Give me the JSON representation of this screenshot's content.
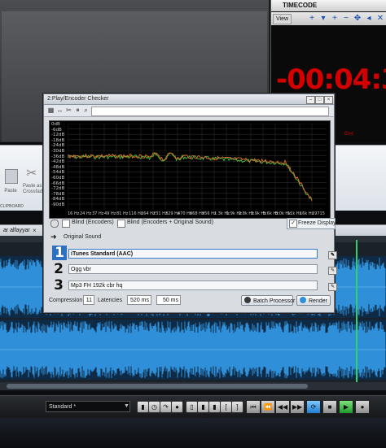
{
  "timecode_panel": {
    "title": "TIMECODE",
    "view_label": "View",
    "value": "-00:04:3",
    "red_text": "End"
  },
  "ribbon": {
    "paste_label": "Paste",
    "paste_as_label": "Paste as\nCrossfade",
    "clipboard_label": "CLIPBOARD"
  },
  "track": {
    "name": "ar alfayyar",
    "close": "×"
  },
  "dialog": {
    "title": "2:Play/Encoder Checker",
    "window_buttons": [
      "–",
      "□",
      "×"
    ],
    "spectrum": {
      "y_labels": [
        "0dB",
        "-6dB",
        "-12dB",
        "-18dB",
        "-24dB",
        "-30dB",
        "-36dB",
        "-42dB",
        "-48dB",
        "-54dB",
        "-60dB",
        "-66dB",
        "-72dB",
        "-78dB",
        "-84dB",
        "-90dB"
      ],
      "x_labels": [
        "16 Hz",
        "24 Hz",
        "37 Hz",
        "49 Hz",
        "81 Hz",
        "116 Hz",
        "164 Hz",
        "231 Hz",
        "329 Hz",
        "470 Hz",
        "668 Hz",
        "956 Hz",
        "1.3k Hz",
        "1.9k Hz",
        "2.8k Hz",
        "3.9k Hz",
        "5.6k Hz",
        "8.0k Hz",
        "11k Hz",
        "16k Hz",
        "19715"
      ]
    },
    "options": {
      "blind_encoders": "Blind (Encoders)",
      "blind_encoders_original": "Blind (Encoders + Original Sound)",
      "freeze_display": "Freeze Display",
      "freeze_checked": "✓"
    },
    "original_sound": "Original Sound",
    "encoders": [
      {
        "num": "1",
        "name": "iTunes Standard (AAC)"
      },
      {
        "num": "2",
        "name": "Ogg vbr"
      },
      {
        "num": "3",
        "name": "Mp3 FH 192k cbr hq"
      }
    ],
    "compression_label": "Compression",
    "compression_value": "11",
    "latencies_label": "Latencies",
    "latency_1": "520 ms",
    "latency_2": "50 ms",
    "batch_processor_label": "Batch Processor",
    "render_label": "Render"
  },
  "transport": {
    "preset": "Standard *"
  },
  "colors": {
    "accent_blue": "#2f8fd8",
    "timecode_red": "#d40000",
    "spectrum_orange": "#e0702a",
    "spectrum_green": "#4cc23a",
    "playhead_green": "#2fd36a"
  }
}
